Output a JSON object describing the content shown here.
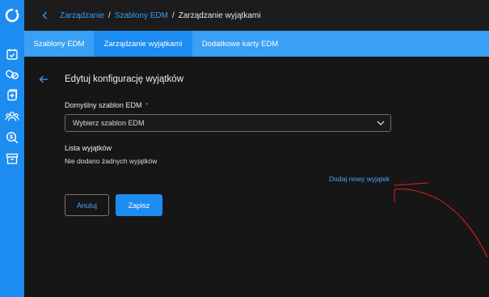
{
  "breadcrumb": {
    "items": [
      "Zarządzanie",
      "Szablony EDM",
      "Zarządzanie wyjątkami"
    ],
    "separator": "/"
  },
  "tabs": [
    {
      "label": "Szablony EDM",
      "active": false
    },
    {
      "label": "Zarządzanie wyjątkami",
      "active": true
    },
    {
      "label": "Dodatkowe karty EDM",
      "active": false
    }
  ],
  "form": {
    "title": "Edytuj konfigurację wyjątków",
    "template_label": "Domyślny szablon EDM",
    "required_mark": "*",
    "template_placeholder": "Wybierz szablon EDM",
    "exceptions_label": "Lista wyjątków",
    "exceptions_empty": "Nie dodano żadnych wyjątków",
    "add_exception_link": "Dodaj nowy wyjątek",
    "cancel_label": "Anuluj",
    "save_label": "Zapisz"
  },
  "colors": {
    "accent": "#1d8cf0",
    "tabs_bar": "#3aa0f5",
    "background": "#141414",
    "link": "#4aa3ff",
    "required": "#ff4d4f",
    "annotation": "#e01f1f"
  },
  "icons": [
    "app-logo-icon",
    "calendar-check-icon",
    "pills-icon",
    "medical-file-icon",
    "users-icon",
    "dollar-search-icon",
    "archive-icon",
    "chevron-left-icon",
    "back-arrow-icon",
    "chevron-down-icon"
  ]
}
